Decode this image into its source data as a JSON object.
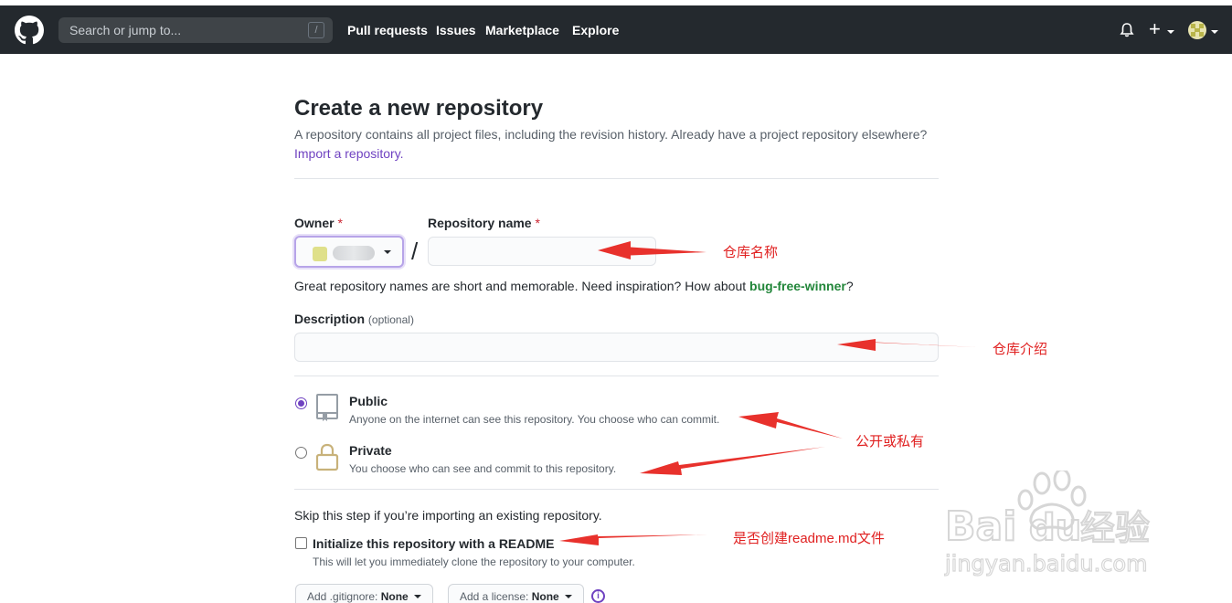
{
  "header": {
    "search_placeholder": "Search or jump to...",
    "search_shortcut": "/",
    "nav": [
      "Pull requests",
      "Issues",
      "Marketplace",
      "Explore"
    ],
    "plus_label": "+",
    "icons": [
      "github-logo-icon",
      "bell-icon",
      "plus-icon",
      "avatar"
    ]
  },
  "page": {
    "title": "Create a new repository",
    "subtitle": "A repository contains all project files, including the revision history. Already have a project repository elsewhere?",
    "import_link": "Import a repository."
  },
  "form": {
    "owner_label": "Owner",
    "repo_label": "Repository name",
    "required_mark": "*",
    "separator": "/",
    "hint_prefix": "Great repository names are short and memorable. Need inspiration? How about ",
    "hint_suggestion": "bug-free-winner",
    "hint_suffix": "?",
    "description_label": "Description",
    "description_optional": "(optional)",
    "visibility": {
      "public_title": "Public",
      "public_desc": "Anyone on the internet can see this repository. You choose who can commit.",
      "public_selected": true,
      "private_title": "Private",
      "private_desc": "You choose who can see and commit to this repository."
    },
    "skip_text": "Skip this step if you’re importing an existing repository.",
    "readme_label": "Initialize this repository with a README",
    "readme_desc": "This will let you immediately clone the repository to your computer.",
    "readme_checked": false,
    "gitignore_prefix": "Add .gitignore:",
    "gitignore_value": "None",
    "license_prefix": "Add a license:",
    "license_value": "None"
  },
  "annotations": {
    "repo_name": "仓库名称",
    "description": "仓库介绍",
    "visibility": "公开或私有",
    "readme": "是否创建readme.md文件"
  },
  "watermark": {
    "brand": "Bai du 经验",
    "url": "jingyan.baidu.com"
  },
  "colors": {
    "header_bg": "#24292e",
    "accent_purple": "#6f42c1",
    "suggestion_green": "#22863a",
    "required_red": "#cb2431",
    "annotation_red": "#e02020"
  }
}
